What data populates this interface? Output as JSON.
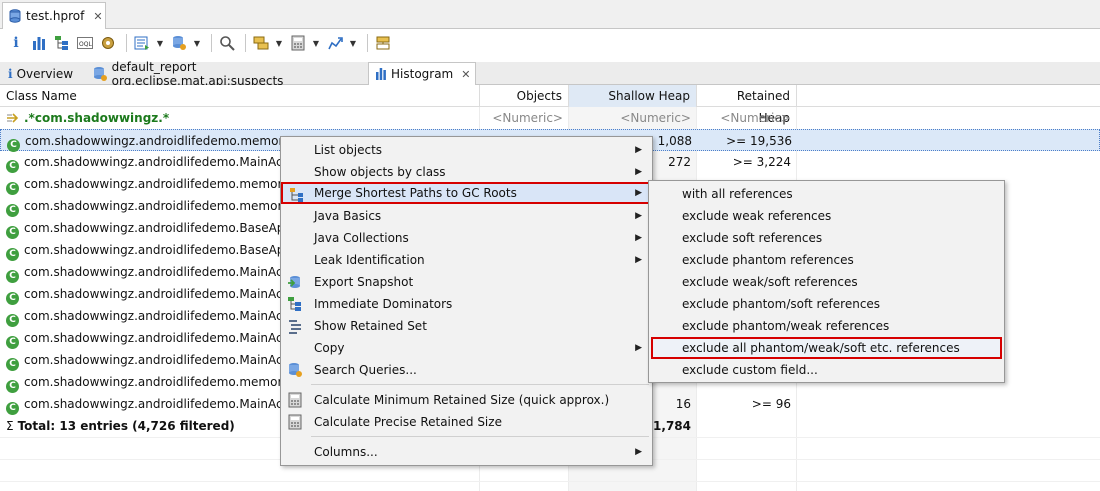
{
  "editor_tab": {
    "label": "test.hprof"
  },
  "view_tabs": [
    {
      "label": "Overview"
    },
    {
      "label": "default_report  org.eclipse.mat.api:suspects"
    },
    {
      "label": "Histogram"
    }
  ],
  "columns": [
    "Class Name",
    "Objects",
    "Shallow Heap",
    "Retained Heap"
  ],
  "filter_row": {
    "class_name": ".*com.shadowwingz.*",
    "objects": "<Numeric>",
    "shallow": "<Numeric>",
    "retained": "<Numeric>"
  },
  "rows": [
    {
      "class_name": "com.shadowwingz.androidlifedemo.memor",
      "shallow": "1,088",
      "retained": ">= 19,536"
    },
    {
      "class_name": "com.shadowwingz.androidlifedemo.MainAc",
      "shallow": "272",
      "retained": ">= 3,224"
    },
    {
      "class_name": "com.shadowwingz.androidlifedemo.memor",
      "shallow": "",
      "retained": ""
    },
    {
      "class_name": "com.shadowwingz.androidlifedemo.memor",
      "shallow": "",
      "retained": ""
    },
    {
      "class_name": "com.shadowwingz.androidlifedemo.BaseAp",
      "shallow": "",
      "retained": ""
    },
    {
      "class_name": "com.shadowwingz.androidlifedemo.BaseAp",
      "shallow": "",
      "retained": ""
    },
    {
      "class_name": "com.shadowwingz.androidlifedemo.MainAc",
      "shallow": "",
      "retained": ""
    },
    {
      "class_name": "com.shadowwingz.androidlifedemo.MainAc",
      "shallow": "",
      "retained": ""
    },
    {
      "class_name": "com.shadowwingz.androidlifedemo.MainAc",
      "shallow": "",
      "retained": ""
    },
    {
      "class_name": "com.shadowwingz.androidlifedemo.MainAc",
      "shallow": "",
      "retained": ""
    },
    {
      "class_name": "com.shadowwingz.androidlifedemo.MainAc",
      "shallow": "",
      "retained": ""
    },
    {
      "class_name": "com.shadowwingz.androidlifedemo.memor",
      "shallow": "",
      "retained": ""
    },
    {
      "class_name": "com.shadowwingz.androidlifedemo.MainAc",
      "shallow": "16",
      "retained": ">= 96"
    }
  ],
  "total_row": {
    "label": "Total: 13 entries (4,726 filtered)",
    "shallow": "1,784"
  },
  "context_menu": {
    "items": [
      {
        "label": "List objects",
        "submenu": true
      },
      {
        "label": "Show objects by class",
        "submenu": true
      },
      {
        "label": "Merge Shortest Paths to GC Roots",
        "submenu": true
      },
      {
        "label": "Java Basics",
        "submenu": true
      },
      {
        "label": "Java Collections",
        "submenu": true
      },
      {
        "label": "Leak Identification",
        "submenu": true
      },
      {
        "label": "Export Snapshot",
        "submenu": false
      },
      {
        "label": "Immediate Dominators",
        "submenu": false
      },
      {
        "label": "Show Retained Set",
        "submenu": false
      },
      {
        "label": "Copy",
        "submenu": true
      },
      {
        "label": "Search Queries...",
        "submenu": false
      },
      {
        "label": "Calculate Minimum Retained Size (quick approx.)",
        "submenu": false
      },
      {
        "label": "Calculate Precise Retained Size",
        "submenu": false
      },
      {
        "label": "Columns...",
        "submenu": true
      }
    ]
  },
  "submenu": {
    "items": [
      {
        "label": "with all references"
      },
      {
        "label": "exclude weak references"
      },
      {
        "label": "exclude soft references"
      },
      {
        "label": "exclude phantom references"
      },
      {
        "label": "exclude weak/soft references"
      },
      {
        "label": "exclude phantom/soft references"
      },
      {
        "label": "exclude phantom/weak references"
      },
      {
        "label": "exclude all phantom/weak/soft etc. references"
      },
      {
        "label": "exclude custom field..."
      }
    ]
  },
  "icons": {
    "accent": "#2f6fc4",
    "highlight_border": "#d60000"
  },
  "symbols": {
    "sum": "Σ",
    "submenu_arrow": "▶",
    "dropdown_arrow": "▼",
    "close": "✕",
    "class_badge": "C",
    "info": "i"
  }
}
